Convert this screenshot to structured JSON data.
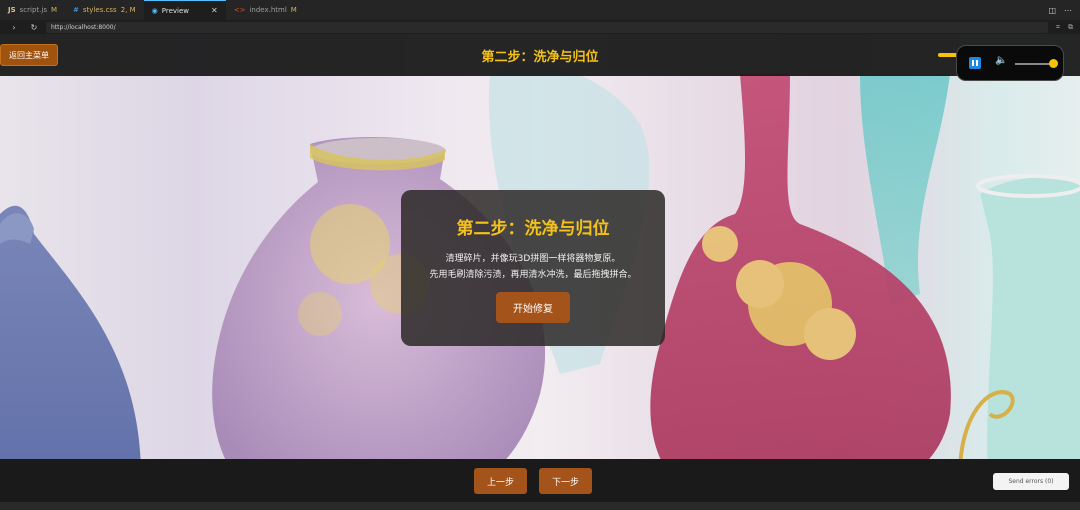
{
  "editor": {
    "tabs": [
      {
        "icon": "JS",
        "label": "script.js",
        "badge": "M"
      },
      {
        "icon": "#",
        "label": "styles.css",
        "badge": "2, M"
      },
      {
        "icon": "◉",
        "label": "Preview",
        "close": "✕"
      },
      {
        "icon": "<>",
        "label": "index.html",
        "badge": "M"
      }
    ],
    "url": "http://localhost:8000/"
  },
  "app": {
    "back_label": "返回主菜单",
    "title": "第二步：洗净与归位",
    "modal": {
      "title": "第二步：洗净与归位",
      "line1": "清理碎片，并像玩3D拼图一样将器物复原。",
      "line2": "先用毛刷清除污渍，再用清水冲洗，最后拖拽拼合。",
      "start_label": "开始修复"
    },
    "prev_label": "上一步",
    "next_label": "下一步",
    "send_errors_label": "Send errors (0)",
    "volume": 1.0
  },
  "colors": {
    "accent_gold": "#f4c21a",
    "button_brown": "#a4531a",
    "play_blue": "#1e88e5"
  }
}
